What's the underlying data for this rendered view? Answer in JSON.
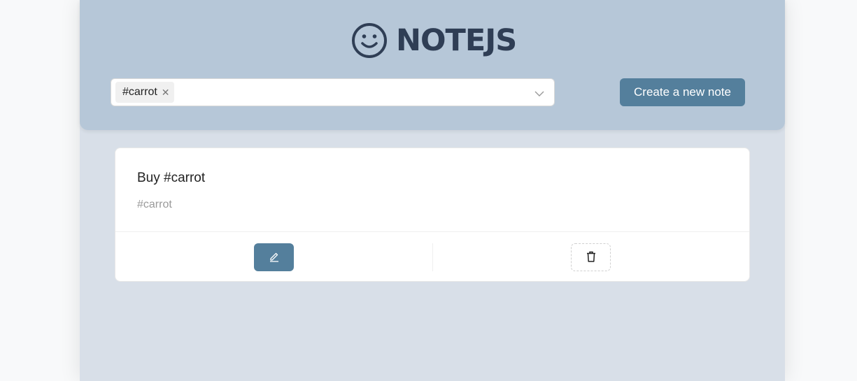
{
  "header": {
    "logo_icon": "smiley-icon",
    "title": "NOTEJS"
  },
  "tag_filter": {
    "selected_tags": [
      "#carrot"
    ],
    "remove_icon": "close-icon",
    "dropdown_icon": "chevron-down-icon"
  },
  "toolbar": {
    "create_label": "Create a new note"
  },
  "notes": [
    {
      "title": "Buy #carrot",
      "tags": "#carrot",
      "edit_icon": "pencil-icon",
      "delete_icon": "trash-icon"
    }
  ],
  "colors": {
    "page_bg": "#f8f9fa",
    "app_bg": "#d8dfe8",
    "header_bg": "#b6c7d8",
    "accent": "#547f9c",
    "logo": "#2f3e55"
  }
}
